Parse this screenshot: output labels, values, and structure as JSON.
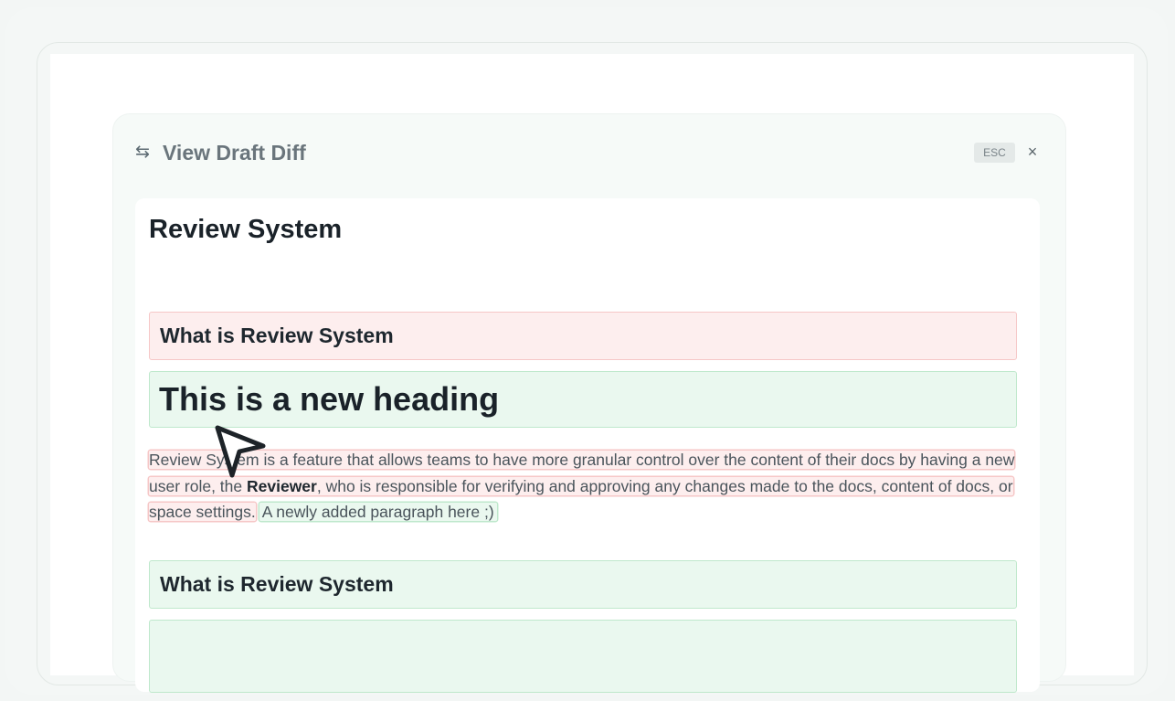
{
  "modal": {
    "icon": "swap-arrows-icon",
    "title": "View Draft Diff",
    "esc_label": "ESC",
    "close_icon": "close-icon",
    "close_symbol": "×"
  },
  "document": {
    "title": "Review System",
    "removed_heading": "What is Review System",
    "added_heading": "This is a new heading",
    "paragraph": {
      "part1": "Review System is a feature that allows teams to have more granular control over the content of their docs by having a new user role, the ",
      "bold": "Reviewer",
      "part2": ", who is responsible for verifying and approving any changes made to the docs, content of docs, or space settings.",
      "added": "A newly added paragraph here ;)"
    },
    "added_heading_2": "What is Review System"
  },
  "colors": {
    "removed_bg": "#fdeeee",
    "removed_border": "#f6c7c7",
    "added_bg": "#eaf8ef",
    "added_border": "#bfe8cc"
  }
}
